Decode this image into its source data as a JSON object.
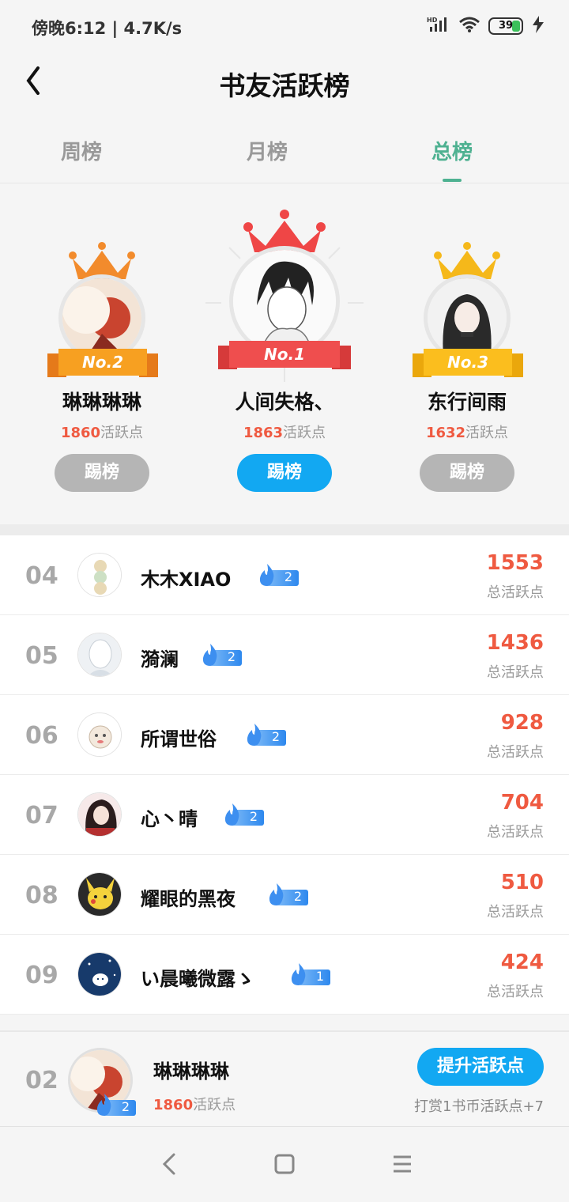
{
  "status": {
    "time_speed": "傍晚6:12 | 4.7K/s",
    "battery": "39",
    "net_label": "HD"
  },
  "header": {
    "title": "书友活跃榜"
  },
  "tabs": [
    {
      "label": "周榜"
    },
    {
      "label": "月榜"
    },
    {
      "label": "总榜",
      "active": true
    }
  ],
  "podium": {
    "first": {
      "rank_label": "No.1",
      "name": "人间失格、",
      "score": "1863",
      "score_unit": "活跃点",
      "button": "踢榜"
    },
    "second": {
      "rank_label": "No.2",
      "name": "琳琳琳琳",
      "score": "1860",
      "score_unit": "活跃点",
      "button": "踢榜"
    },
    "third": {
      "rank_label": "No.3",
      "name": "东行间雨",
      "score": "1632",
      "score_unit": "活跃点",
      "button": "踢榜"
    }
  },
  "list": [
    {
      "rank": "04",
      "name": "木木XIAO",
      "level": "2",
      "score": "1553",
      "label": "总活跃点"
    },
    {
      "rank": "05",
      "name": "漪澜",
      "level": "2",
      "score": "1436",
      "label": "总活跃点"
    },
    {
      "rank": "06",
      "name": "所谓世俗",
      "level": "2",
      "score": "928",
      "label": "总活跃点"
    },
    {
      "rank": "07",
      "name": "心丶晴",
      "level": "2",
      "score": "704",
      "label": "总活跃点"
    },
    {
      "rank": "08",
      "name": "耀眼的黑夜",
      "level": "2",
      "score": "510",
      "label": "总活跃点"
    },
    {
      "rank": "09",
      "name": "い晨曦微露ゝ",
      "level": "1",
      "score": "424",
      "label": "总活跃点"
    }
  ],
  "my": {
    "rank": "02",
    "name": "琳琳琳琳",
    "level": "2",
    "score": "1860",
    "score_unit": "活跃点",
    "boost_button": "提升活跃点",
    "hint": "打赏1书币活跃点+7"
  },
  "colors": {
    "accent_green": "#4eb191",
    "accent_blue": "#12a8f2",
    "score_red": "#ef5a41"
  }
}
